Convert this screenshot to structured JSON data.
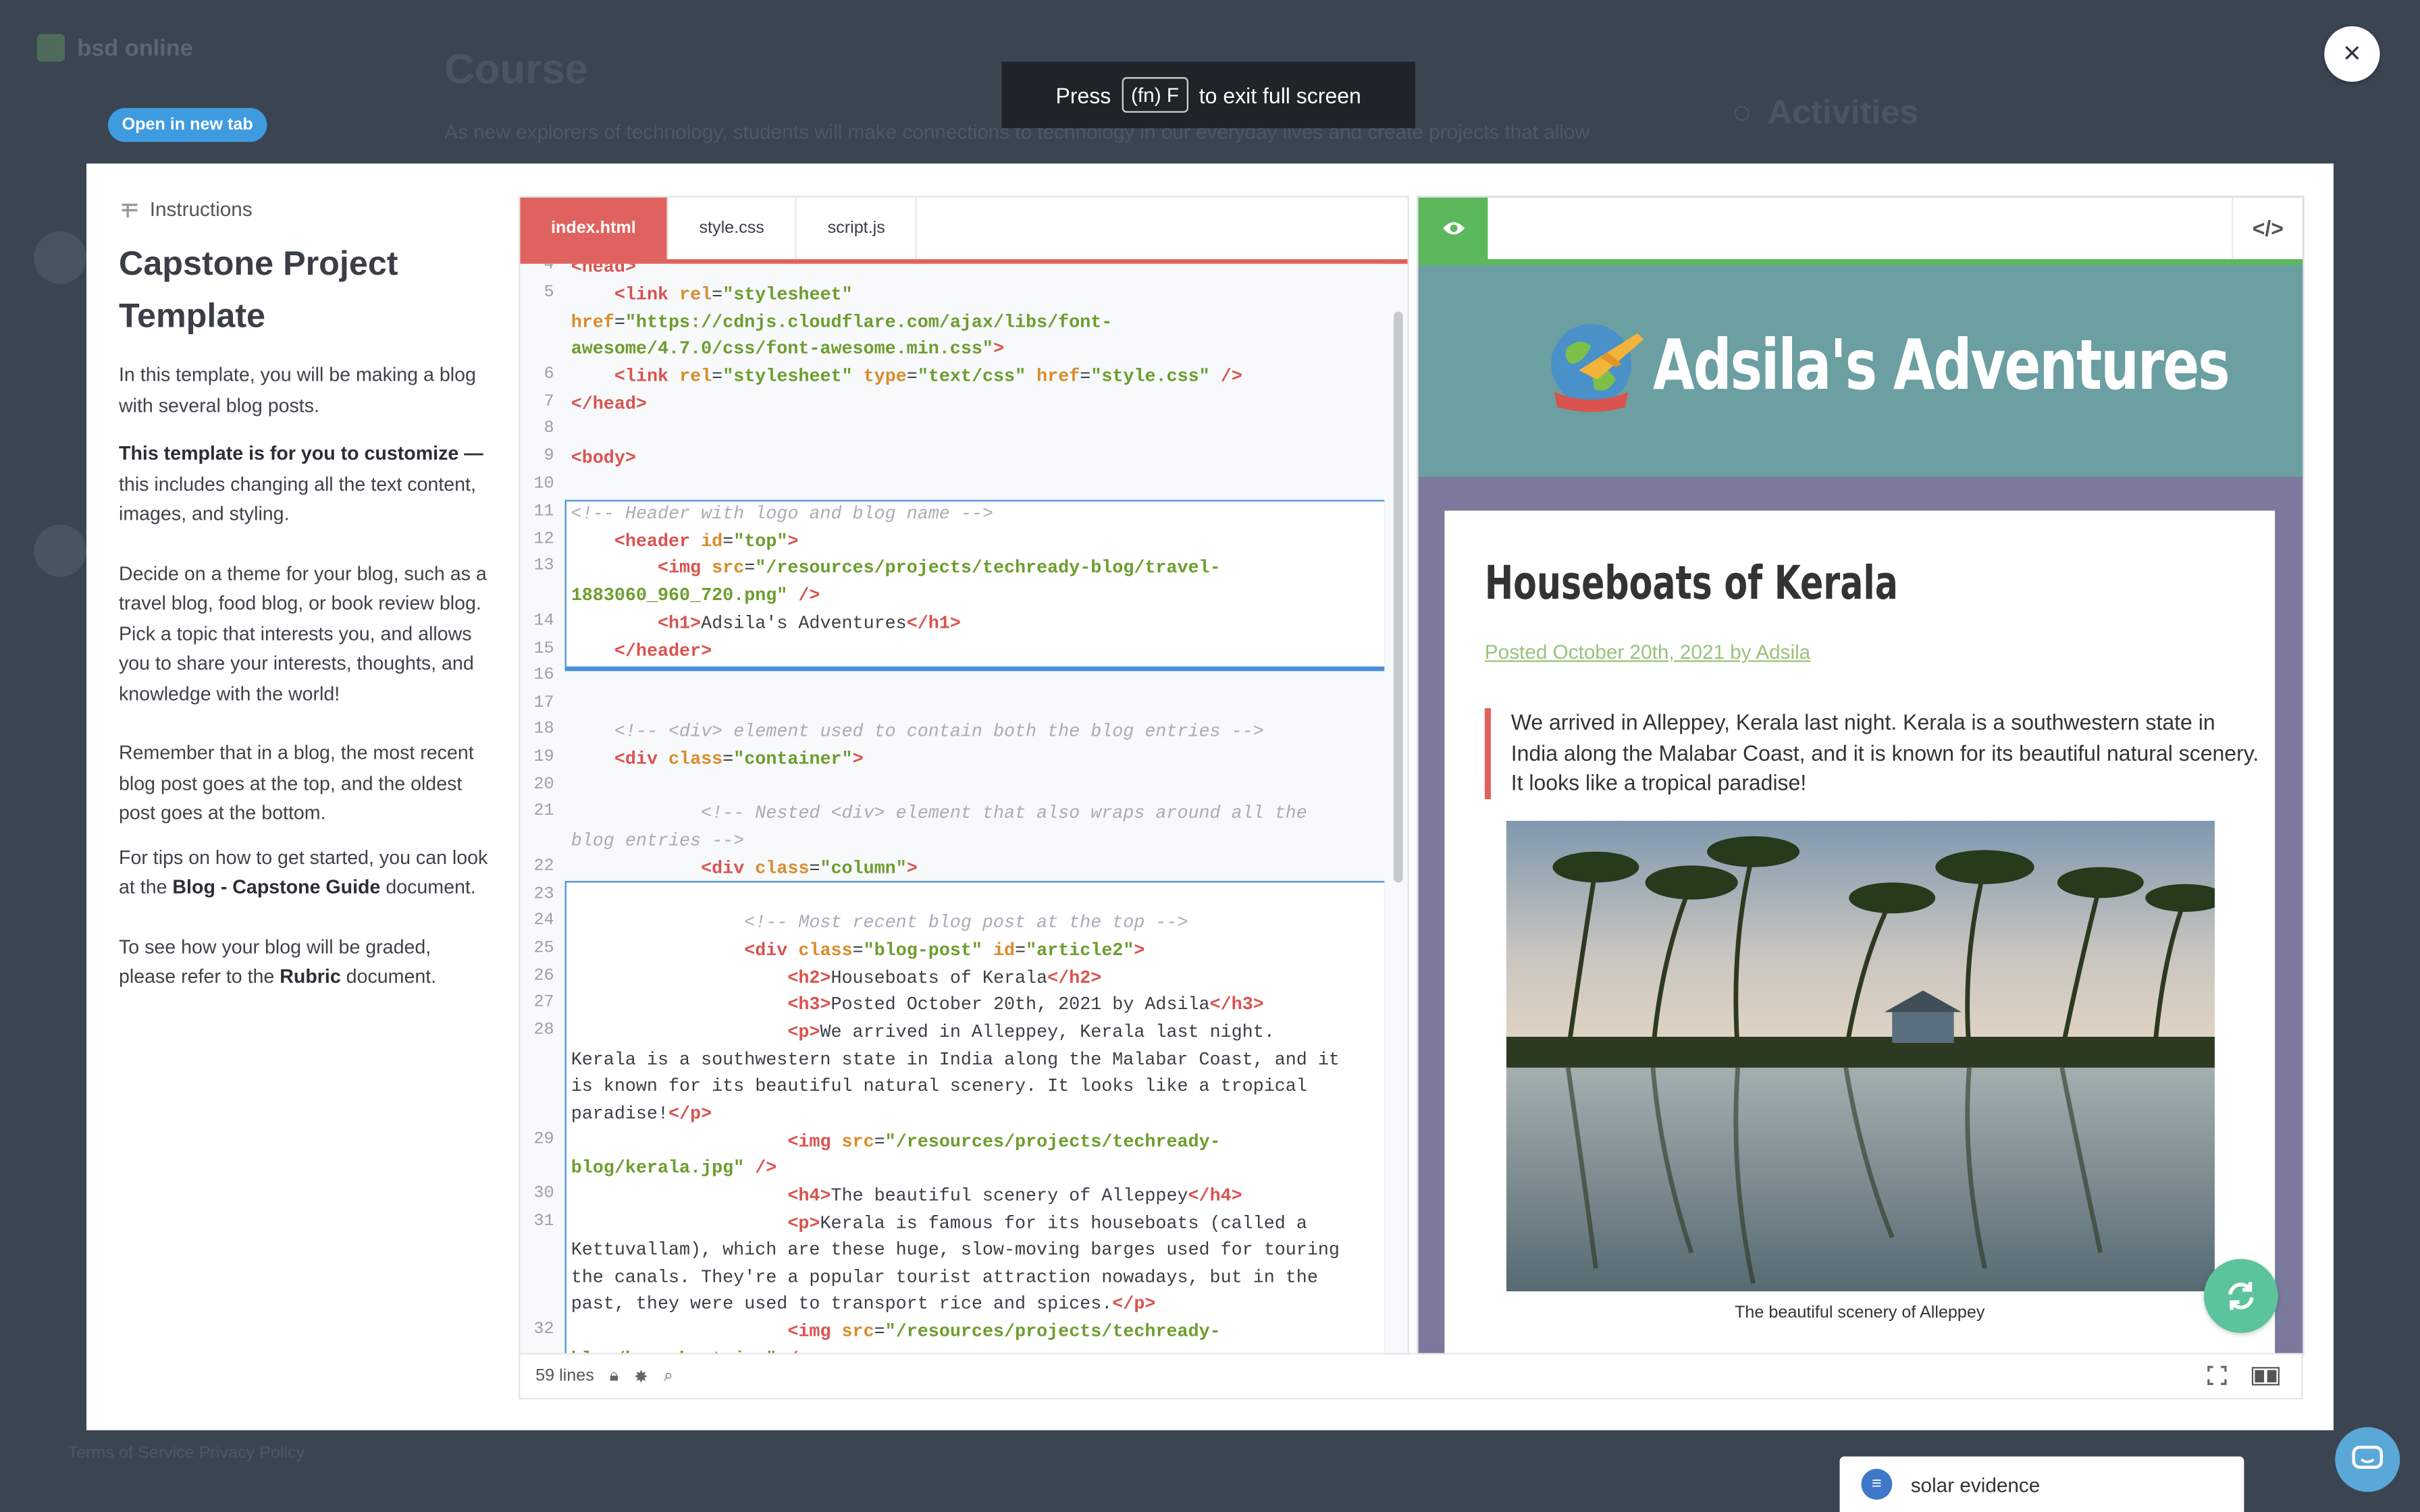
{
  "background": {
    "brand": "bsd online",
    "course_title": "Course",
    "course_subtitle": "As new explorers of technology, students will make connections to technology in our everyday lives and create projects that allow",
    "activities": "Activities",
    "footer": "Terms of Service   Privacy Policy"
  },
  "fullscreen_toast": {
    "press": "Press",
    "key": "(fn) F",
    "rest": "to exit full screen"
  },
  "open_new_tab": "Open in new tab",
  "close_symbol": "×",
  "instructions": {
    "header": "Instructions",
    "title": "Capstone Project Template",
    "p1": "In this template, you will be making a blog with several blog posts.",
    "p2_bold": "This template is for you to customize —",
    "p2_rest": " this includes changing all the text content, images, and styling.",
    "p3": "Decide on a theme for your blog, such as a travel blog, food blog, or book review blog. Pick a topic that interests you, and allows you to share your interests, thoughts, and knowledge with the world!",
    "p4": "Remember that in a blog, the most recent blog post goes at the top, and the oldest post goes at the bottom.",
    "p5_a": "For tips on how to get started, you can look at the ",
    "p5_bold": "Blog - Capstone Guide",
    "p5_b": " document.",
    "p6_a": "To see how your blog will be graded, please refer to the ",
    "p6_bold": "Rubric",
    "p6_b": " document."
  },
  "editor": {
    "tabs": [
      "index.html",
      "style.css",
      "script.js"
    ],
    "status_lines": "59 lines"
  },
  "preview": {
    "blog_title": "Adsila's Adventures",
    "post_title": "Houseboats of Kerala",
    "post_meta": "Posted October 20th, 2021 by Adsila",
    "post_text": "We arrived in Alleppey, Kerala last night. Kerala is a southwestern state in India along the Malabar Coast, and it is known for its beautiful natural scenery. It looks like a tropical paradise!",
    "caption": "The beautiful scenery of Alleppey"
  },
  "chat": {
    "label": "solar evidence"
  },
  "colors": {
    "accent_red": "#e0625f",
    "accent_green": "#5cb85c",
    "header_teal": "#6b9fa2",
    "link_blue": "#3f9be0"
  }
}
